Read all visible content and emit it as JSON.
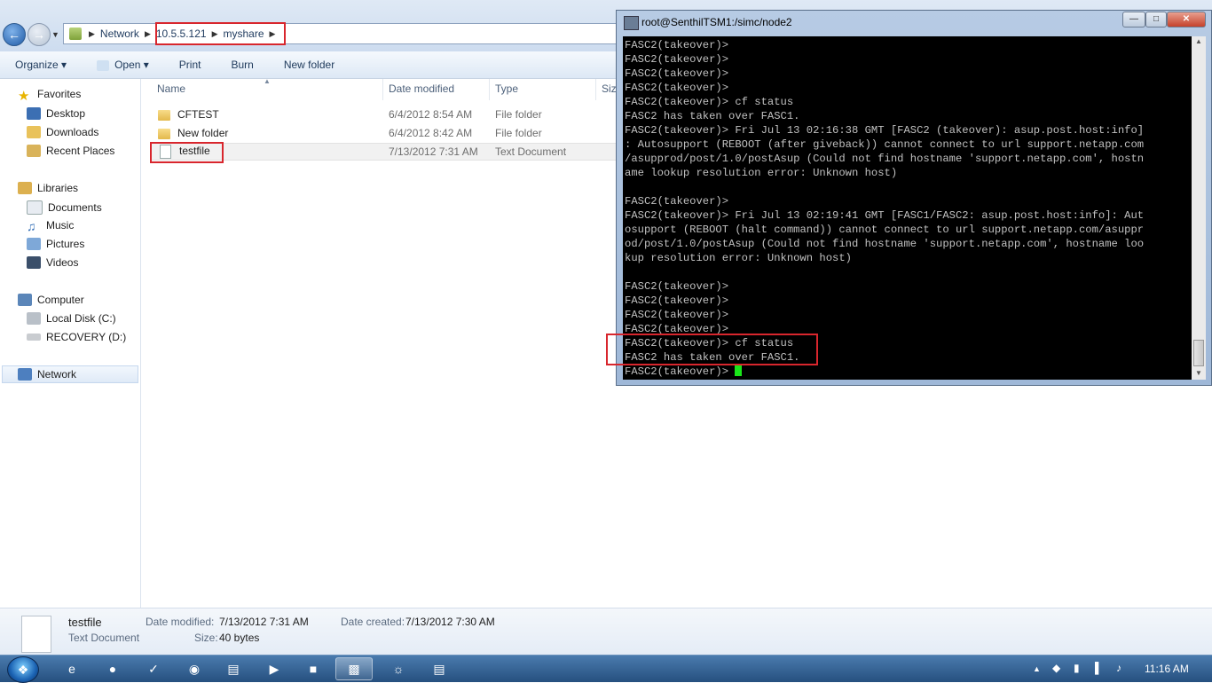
{
  "explorer": {
    "breadcrumb": [
      "Network",
      "10.5.5.121",
      "myshare"
    ],
    "toolbar": [
      "Organize",
      "Open",
      "Print",
      "Burn",
      "New folder"
    ],
    "nav": {
      "favorites": "Favorites",
      "favorites_items": [
        "Desktop",
        "Downloads",
        "Recent Places"
      ],
      "libraries": "Libraries",
      "libraries_items": [
        "Documents",
        "Music",
        "Pictures",
        "Videos"
      ],
      "computer": "Computer",
      "computer_items": [
        "Local Disk (C:)",
        "RECOVERY (D:)"
      ],
      "network": "Network"
    },
    "columns": [
      "Name",
      "Date modified",
      "Type",
      "Size"
    ],
    "files": [
      {
        "name": "CFTEST",
        "date": "6/4/2012 8:54 AM",
        "type": "File folder",
        "icon": "folder-icon"
      },
      {
        "name": "New folder",
        "date": "6/4/2012 8:42 AM",
        "type": "File folder",
        "icon": "folder-icon"
      },
      {
        "name": "testfile",
        "date": "7/13/2012 7:31 AM",
        "type": "Text Document",
        "icon": "text-document-icon",
        "selected": true
      }
    ],
    "details": {
      "name": "testfile",
      "kind": "Text Document",
      "modified_label": "Date modified:",
      "modified": "7/13/2012 7:31 AM",
      "created_label": "Date created:",
      "created": "7/13/2012 7:30 AM",
      "size_label": "Size:",
      "size": "40 bytes"
    }
  },
  "terminal": {
    "title": "root@SenthilTSM1:/simc/node2",
    "lines": [
      "FASC2(takeover)>",
      "FASC2(takeover)>",
      "FASC2(takeover)>",
      "FASC2(takeover)>",
      "FASC2(takeover)> cf status",
      "FASC2 has taken over FASC1.",
      "FASC2(takeover)> Fri Jul 13 02:16:38 GMT [FASC2 (takeover): asup.post.host:info]",
      ": Autosupport (REBOOT (after giveback)) cannot connect to url support.netapp.com",
      "/asupprod/post/1.0/postAsup (Could not find hostname 'support.netapp.com', hostn",
      "ame lookup resolution error: Unknown host)",
      "",
      "FASC2(takeover)>",
      "FASC2(takeover)> Fri Jul 13 02:19:41 GMT [FASC1/FASC2: asup.post.host:info]: Aut",
      "osupport (REBOOT (halt command)) cannot connect to url support.netapp.com/asuppr",
      "od/post/1.0/postAsup (Could not find hostname 'support.netapp.com', hostname loo",
      "kup resolution error: Unknown host)",
      "",
      "FASC2(takeover)>",
      "FASC2(takeover)>",
      "FASC2(takeover)>",
      "FASC2(takeover)>",
      "FASC2(takeover)> cf status",
      "FASC2 has taken over FASC1."
    ],
    "prompt": "FASC2(takeover)> "
  },
  "taskbar": {
    "clock": "11:16 AM",
    "apps": [
      "internet-explorer-icon",
      "hp-icon",
      "mail-icon",
      "media-icon",
      "explorer-icon",
      "media-player-icon",
      "folder-app-icon",
      "putty-icon",
      "network-app-icon",
      "notepad-icon"
    ]
  },
  "colors": {
    "highlight_box": "#d8262d",
    "cursor": "#19e619",
    "terminal_bg": "#000000",
    "terminal_fg": "#c0c0c0"
  }
}
